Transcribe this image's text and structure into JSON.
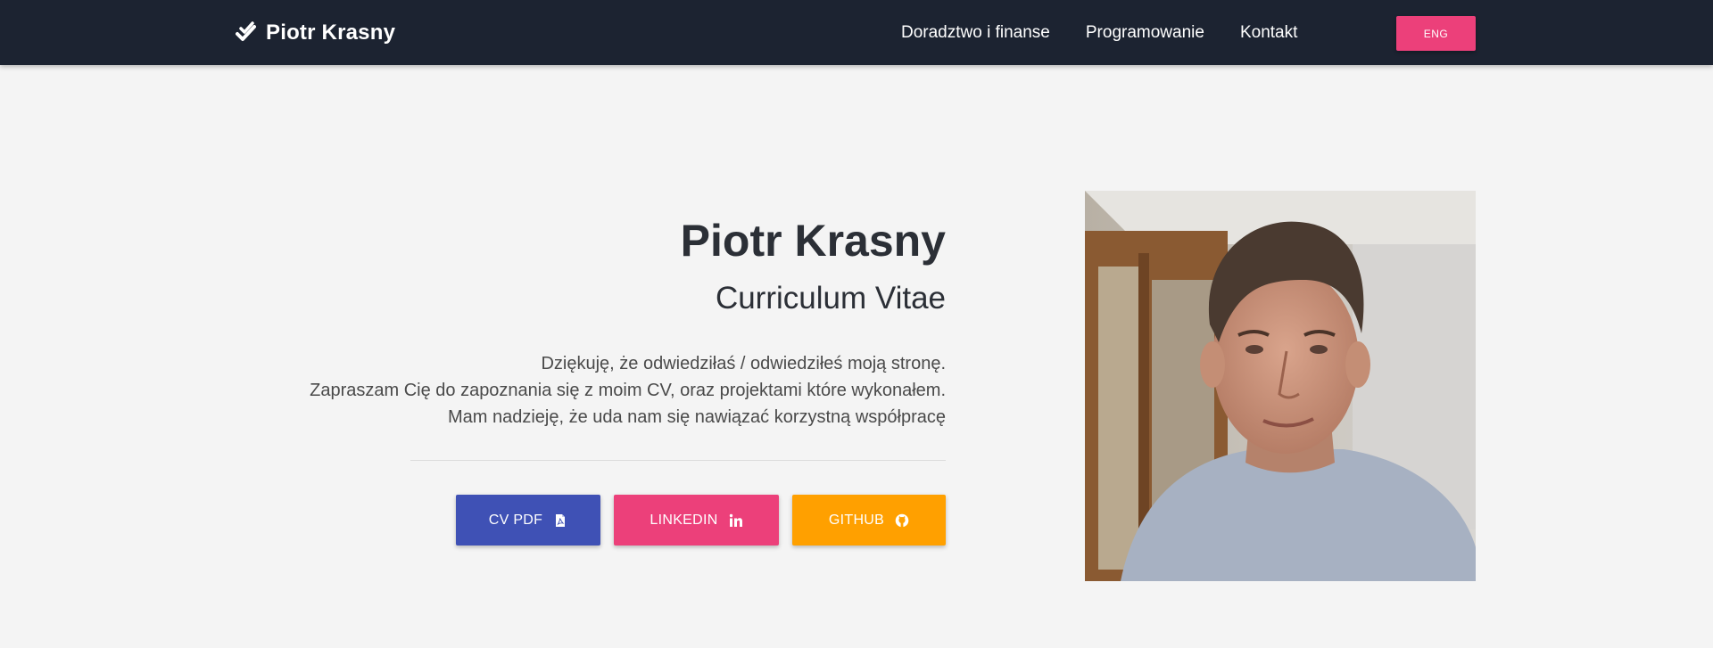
{
  "navbar": {
    "brand": {
      "name": "Piotr Krasny",
      "icon": "double-check-icon"
    },
    "links": [
      {
        "label": "Doradztwo i finanse"
      },
      {
        "label": "Programowanie"
      },
      {
        "label": "Kontakt"
      }
    ],
    "language_button": "ENG"
  },
  "hero": {
    "title": "Piotr Krasny",
    "subtitle": "Curriculum Vitae",
    "description": [
      "Dziękuję, że odwiedziłaś / odwiedziłeś moją stronę.",
      "Zapraszam Cię do zapoznania się z moim CV, oraz projektami które wykonałem.",
      "Mam nadzieję, że uda nam się nawiązać korzystną współpracę"
    ],
    "buttons": [
      {
        "label": "CV PDF",
        "icon": "file-pdf-icon",
        "color": "#3f51b5"
      },
      {
        "label": "LINKEDIN",
        "icon": "linkedin-icon",
        "color": "#ec407a"
      },
      {
        "label": "GITHUB",
        "icon": "github-icon",
        "color": "#ffa000"
      }
    ]
  },
  "colors": {
    "navbar_bg": "#1c2331",
    "accent_pink": "#ec407a",
    "accent_indigo": "#3f51b5",
    "accent_amber": "#ffa000",
    "page_bg": "#f4f4f4"
  }
}
